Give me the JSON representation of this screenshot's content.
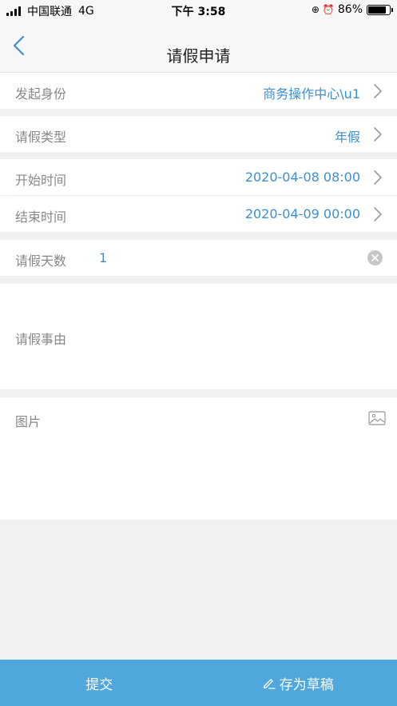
{
  "status_bar": {
    "carrier": "中国联通",
    "network": "4G",
    "time": "下午 3:58",
    "battery": "86%",
    "battery_level": 0.86
  },
  "nav": {
    "title": "请假申请",
    "back_icon": "chevron-left-icon"
  },
  "form": {
    "initiator": {
      "label": "发起身份",
      "value": "商务操作中心\\u1"
    },
    "leave_type": {
      "label": "请假类型",
      "value": "年假"
    },
    "start_time": {
      "label": "开始时间",
      "value": "2020-04-08 08:00"
    },
    "end_time": {
      "label": "结束时间",
      "value": "2020-04-09 00:00"
    },
    "days": {
      "label": "请假天数",
      "value": "1"
    },
    "reason": {
      "label": "请假事由",
      "value": ""
    },
    "images": {
      "label": "图片",
      "icon": "image-icon"
    }
  },
  "actions": {
    "submit_label": "提交",
    "draft_label": "存为草稿"
  },
  "colors": {
    "accent": "#3d8fd1",
    "bottom_bar": "#4fa7dc",
    "label": "#888888",
    "background": "#f0f1f3"
  }
}
